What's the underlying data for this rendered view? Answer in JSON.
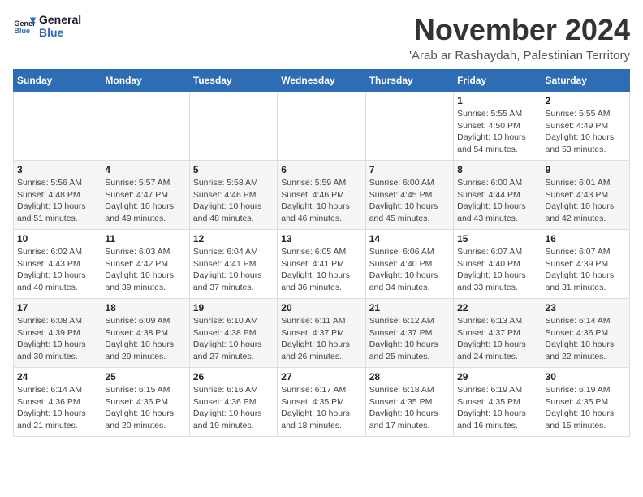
{
  "logo": {
    "line1": "General",
    "line2": "Blue"
  },
  "header": {
    "month": "November 2024",
    "location": "'Arab ar Rashaydah, Palestinian Territory"
  },
  "weekdays": [
    "Sunday",
    "Monday",
    "Tuesday",
    "Wednesday",
    "Thursday",
    "Friday",
    "Saturday"
  ],
  "weeks": [
    [
      {
        "day": "",
        "info": ""
      },
      {
        "day": "",
        "info": ""
      },
      {
        "day": "",
        "info": ""
      },
      {
        "day": "",
        "info": ""
      },
      {
        "day": "",
        "info": ""
      },
      {
        "day": "1",
        "info": "Sunrise: 5:55 AM\nSunset: 4:50 PM\nDaylight: 10 hours\nand 54 minutes."
      },
      {
        "day": "2",
        "info": "Sunrise: 5:55 AM\nSunset: 4:49 PM\nDaylight: 10 hours\nand 53 minutes."
      }
    ],
    [
      {
        "day": "3",
        "info": "Sunrise: 5:56 AM\nSunset: 4:48 PM\nDaylight: 10 hours\nand 51 minutes."
      },
      {
        "day": "4",
        "info": "Sunrise: 5:57 AM\nSunset: 4:47 PM\nDaylight: 10 hours\nand 49 minutes."
      },
      {
        "day": "5",
        "info": "Sunrise: 5:58 AM\nSunset: 4:46 PM\nDaylight: 10 hours\nand 48 minutes."
      },
      {
        "day": "6",
        "info": "Sunrise: 5:59 AM\nSunset: 4:46 PM\nDaylight: 10 hours\nand 46 minutes."
      },
      {
        "day": "7",
        "info": "Sunrise: 6:00 AM\nSunset: 4:45 PM\nDaylight: 10 hours\nand 45 minutes."
      },
      {
        "day": "8",
        "info": "Sunrise: 6:00 AM\nSunset: 4:44 PM\nDaylight: 10 hours\nand 43 minutes."
      },
      {
        "day": "9",
        "info": "Sunrise: 6:01 AM\nSunset: 4:43 PM\nDaylight: 10 hours\nand 42 minutes."
      }
    ],
    [
      {
        "day": "10",
        "info": "Sunrise: 6:02 AM\nSunset: 4:43 PM\nDaylight: 10 hours\nand 40 minutes."
      },
      {
        "day": "11",
        "info": "Sunrise: 6:03 AM\nSunset: 4:42 PM\nDaylight: 10 hours\nand 39 minutes."
      },
      {
        "day": "12",
        "info": "Sunrise: 6:04 AM\nSunset: 4:41 PM\nDaylight: 10 hours\nand 37 minutes."
      },
      {
        "day": "13",
        "info": "Sunrise: 6:05 AM\nSunset: 4:41 PM\nDaylight: 10 hours\nand 36 minutes."
      },
      {
        "day": "14",
        "info": "Sunrise: 6:06 AM\nSunset: 4:40 PM\nDaylight: 10 hours\nand 34 minutes."
      },
      {
        "day": "15",
        "info": "Sunrise: 6:07 AM\nSunset: 4:40 PM\nDaylight: 10 hours\nand 33 minutes."
      },
      {
        "day": "16",
        "info": "Sunrise: 6:07 AM\nSunset: 4:39 PM\nDaylight: 10 hours\nand 31 minutes."
      }
    ],
    [
      {
        "day": "17",
        "info": "Sunrise: 6:08 AM\nSunset: 4:39 PM\nDaylight: 10 hours\nand 30 minutes."
      },
      {
        "day": "18",
        "info": "Sunrise: 6:09 AM\nSunset: 4:38 PM\nDaylight: 10 hours\nand 29 minutes."
      },
      {
        "day": "19",
        "info": "Sunrise: 6:10 AM\nSunset: 4:38 PM\nDaylight: 10 hours\nand 27 minutes."
      },
      {
        "day": "20",
        "info": "Sunrise: 6:11 AM\nSunset: 4:37 PM\nDaylight: 10 hours\nand 26 minutes."
      },
      {
        "day": "21",
        "info": "Sunrise: 6:12 AM\nSunset: 4:37 PM\nDaylight: 10 hours\nand 25 minutes."
      },
      {
        "day": "22",
        "info": "Sunrise: 6:13 AM\nSunset: 4:37 PM\nDaylight: 10 hours\nand 24 minutes."
      },
      {
        "day": "23",
        "info": "Sunrise: 6:14 AM\nSunset: 4:36 PM\nDaylight: 10 hours\nand 22 minutes."
      }
    ],
    [
      {
        "day": "24",
        "info": "Sunrise: 6:14 AM\nSunset: 4:36 PM\nDaylight: 10 hours\nand 21 minutes."
      },
      {
        "day": "25",
        "info": "Sunrise: 6:15 AM\nSunset: 4:36 PM\nDaylight: 10 hours\nand 20 minutes."
      },
      {
        "day": "26",
        "info": "Sunrise: 6:16 AM\nSunset: 4:36 PM\nDaylight: 10 hours\nand 19 minutes."
      },
      {
        "day": "27",
        "info": "Sunrise: 6:17 AM\nSunset: 4:35 PM\nDaylight: 10 hours\nand 18 minutes."
      },
      {
        "day": "28",
        "info": "Sunrise: 6:18 AM\nSunset: 4:35 PM\nDaylight: 10 hours\nand 17 minutes."
      },
      {
        "day": "29",
        "info": "Sunrise: 6:19 AM\nSunset: 4:35 PM\nDaylight: 10 hours\nand 16 minutes."
      },
      {
        "day": "30",
        "info": "Sunrise: 6:19 AM\nSunset: 4:35 PM\nDaylight: 10 hours\nand 15 minutes."
      }
    ]
  ]
}
